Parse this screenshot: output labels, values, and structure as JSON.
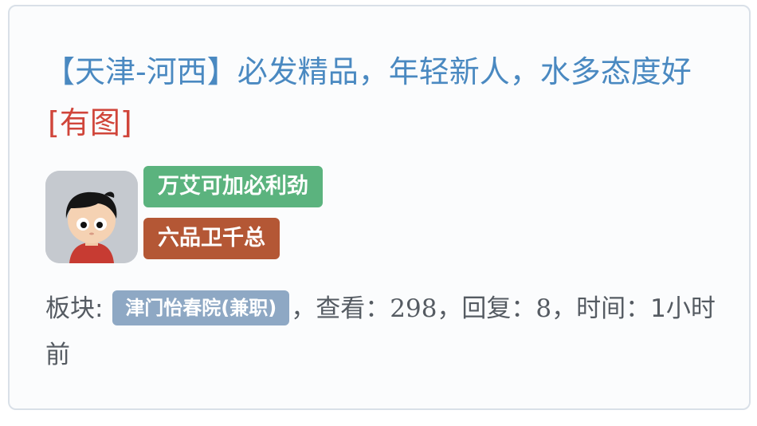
{
  "post": {
    "title": "【天津-河西】必发精品，年轻新人，水多态度好",
    "has_image_tag": "[有图]"
  },
  "author": {
    "avatar_icon": "cartoon-boy-avatar-icon",
    "title_badge": "万艾可加必利劲",
    "title_badge_color": "#5bb37e",
    "rank_badge": "六品卫千总",
    "rank_badge_color": "#b45735"
  },
  "meta": {
    "board_label": "板块:",
    "board_name": "津门怡春院(兼职)",
    "views_label": "，查看：",
    "views": "298",
    "replies_label": "，回复：",
    "replies": "8",
    "time_label": "，时间：",
    "time": "1小时前"
  },
  "colors": {
    "title_link": "#4a89c1",
    "image_tag": "#d0453a",
    "board_tag": "#8ea8c4",
    "meta_text": "#555b62"
  }
}
